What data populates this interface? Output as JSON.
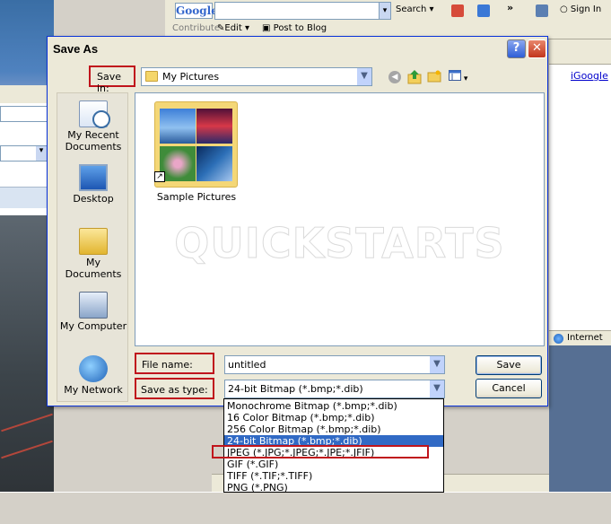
{
  "background": {
    "google_logo": "Google",
    "google_search_label": "Search",
    "sign_in": "Sign In",
    "contribute": "Contribute",
    "edit": "Edit",
    "post_to_blog": "Post to Blog",
    "igoogle": "iGoogle",
    "zone": "Internet"
  },
  "dialog": {
    "title": "Save As",
    "help_glyph": "?",
    "close_glyph": "✕",
    "save_in_label": "Save in:",
    "save_in_value": "My Pictures",
    "back_glyph": "◀",
    "places": [
      {
        "label": "My Recent Documents"
      },
      {
        "label": "Desktop"
      },
      {
        "label": "My Documents"
      },
      {
        "label": "My Computer"
      },
      {
        "label": "My Network"
      }
    ],
    "files": [
      {
        "name": "Sample Pictures"
      }
    ],
    "watermark": "QUICKSTARTS",
    "file_name_label": "File name:",
    "file_name_value": "untitled",
    "save_type_label": "Save as type:",
    "save_type_value": "24-bit Bitmap (*.bmp;*.dib)",
    "save_button": "Save",
    "cancel_button": "Cancel",
    "type_options": [
      "Monochrome Bitmap (*.bmp;*.dib)",
      "16 Color Bitmap (*.bmp;*.dib)",
      "256 Color Bitmap (*.bmp;*.dib)",
      "24-bit Bitmap (*.bmp;*.dib)",
      "JPEG (*.JPG;*.JPEG;*.JPE;*.JFIF)",
      "GIF (*.GIF)",
      "TIFF (*.TIF;*.TIFF)",
      "PNG (*.PNG)"
    ],
    "selected_option_index": 3
  },
  "colors": {
    "highlight_box": "#c0141c",
    "selection": "#316ac5",
    "xp_blue": "#0831d9"
  }
}
